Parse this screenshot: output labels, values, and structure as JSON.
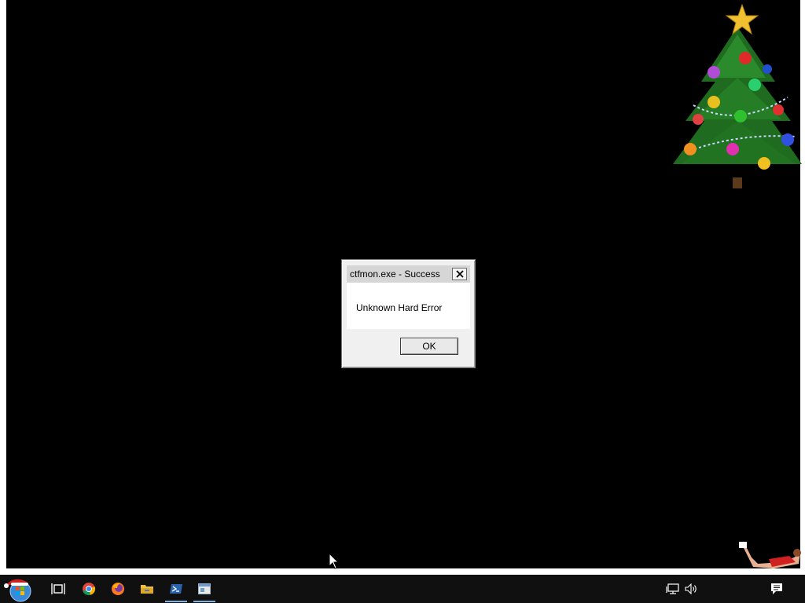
{
  "dialog": {
    "title": "ctfmon.exe - Success",
    "message": "Unknown Hard Error",
    "ok_label": "OK"
  },
  "taskbar": {
    "items": [
      {
        "name": "start-button",
        "icon": "start-orb-santa-icon"
      },
      {
        "name": "task-view-button",
        "icon": "task-view-icon"
      },
      {
        "name": "chrome-button",
        "icon": "chrome-icon"
      },
      {
        "name": "firefox-button",
        "icon": "firefox-icon"
      },
      {
        "name": "file-explorer-button",
        "icon": "folder-icon"
      },
      {
        "name": "powershell-button",
        "icon": "powershell-icon",
        "active": true
      },
      {
        "name": "window-button",
        "icon": "window-icon",
        "active": true
      }
    ],
    "tray": [
      {
        "name": "network-icon"
      },
      {
        "name": "volume-icon"
      },
      {
        "name": "notifications-icon"
      }
    ]
  },
  "colors": {
    "desktop_background": "#000000",
    "taskbar_background": "#101010",
    "active_indicator": "#7fb0e0"
  }
}
